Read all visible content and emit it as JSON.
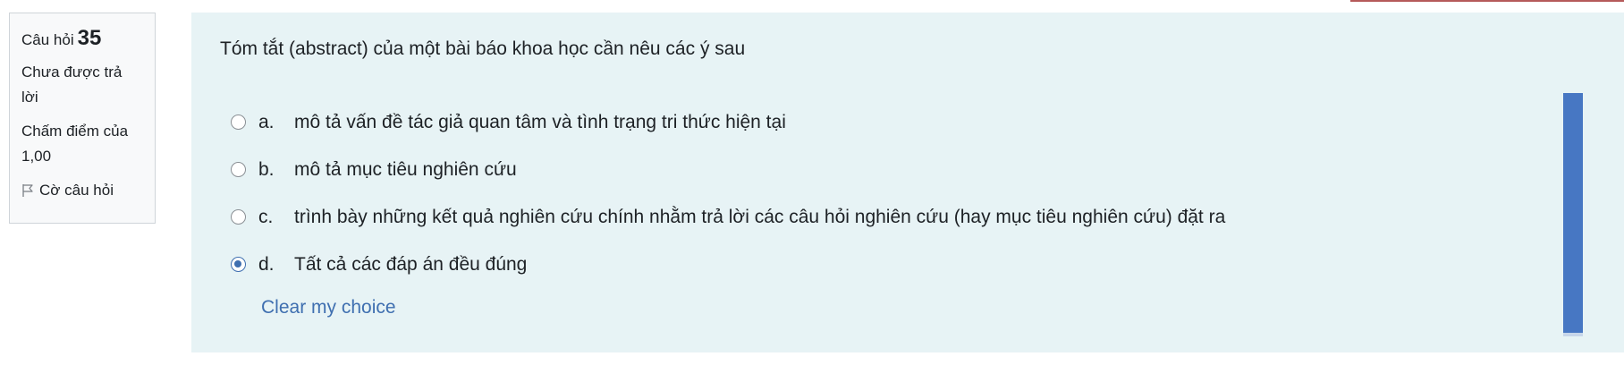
{
  "info": {
    "question_label": "Câu hỏi",
    "question_number": "35",
    "state_line1": "Chưa được trả",
    "state_line2": "lời",
    "grade_line1": "Chấm điểm của",
    "grade_line2": "1,00",
    "flag_label": "Cờ câu hỏi"
  },
  "question": {
    "text": "Tóm tắt (abstract) của một bài báo khoa học cần nêu các ý sau"
  },
  "answers": [
    {
      "letter": "a.",
      "text": "mô tả vấn đề tác giả quan tâm và tình trạng tri thức hiện tại",
      "selected": false
    },
    {
      "letter": "b.",
      "text": "mô tả mục tiêu nghiên cứu",
      "selected": false
    },
    {
      "letter": "c.",
      "text": "trình bày những kết quả nghiên cứu chính nhằm trả lời các câu hỏi nghiên cứu (hay mục tiêu nghiên cứu) đặt ra",
      "selected": false
    },
    {
      "letter": "d.",
      "text": "Tất cả các đáp án đều đúng",
      "selected": true
    }
  ],
  "clear_choice": "Clear my choice",
  "colors": {
    "accent": "#3f6fb0",
    "content_background": "#e7f3f5",
    "scrollbar": "#4777c3"
  }
}
